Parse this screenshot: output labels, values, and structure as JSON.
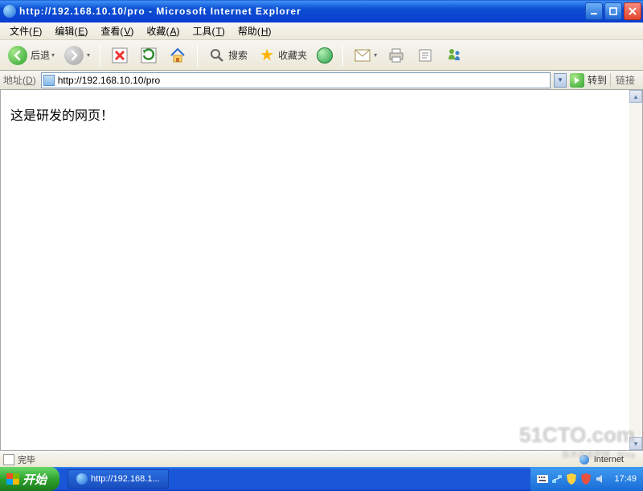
{
  "titlebar": {
    "title": "http://192.168.10.10/pro - Microsoft Internet Explorer"
  },
  "menu": {
    "items": [
      {
        "label": "文件",
        "hotkey": "F"
      },
      {
        "label": "编辑",
        "hotkey": "E"
      },
      {
        "label": "查看",
        "hotkey": "V"
      },
      {
        "label": "收藏",
        "hotkey": "A"
      },
      {
        "label": "工具",
        "hotkey": "T"
      },
      {
        "label": "帮助",
        "hotkey": "H"
      }
    ]
  },
  "toolbar": {
    "back_label": "后退",
    "search_label": "搜索",
    "favorites_label": "收藏夹"
  },
  "addressbar": {
    "label": "地址",
    "hotkey": "D",
    "url": "http://192.168.10.10/pro",
    "go_label": "转到",
    "links_label": "链接"
  },
  "page": {
    "body_text": "这是研发的网页！"
  },
  "statusbar": {
    "status": "完毕",
    "zone": "Internet"
  },
  "taskbar": {
    "start_label": "开始",
    "task_title": "http://192.168.1...",
    "clock": "17:49"
  },
  "watermark": {
    "text": "51CTO.com",
    "sub": "技术成就梦想 · Blog"
  }
}
